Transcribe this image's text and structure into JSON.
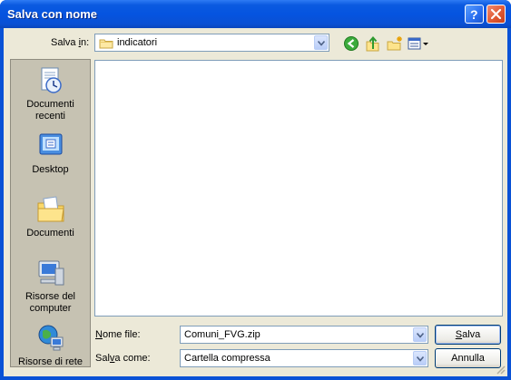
{
  "window": {
    "title": "Salva con nome"
  },
  "toolbar": {
    "look_in_label_pre": "Salva ",
    "look_in_label_key": "i",
    "look_in_label_post": "n:",
    "current_folder": "indicatori",
    "icons": [
      "back-icon",
      "up-folder-icon",
      "new-folder-icon",
      "view-menu-icon"
    ]
  },
  "places": [
    {
      "name": "place-recent",
      "label_line1": "Documenti",
      "label_line2": "recenti",
      "icon": "recent-documents-icon"
    },
    {
      "name": "place-desktop",
      "label_line1": "Desktop",
      "label_line2": "",
      "icon": "desktop-icon"
    },
    {
      "name": "place-documents",
      "label_line1": "Documenti",
      "label_line2": "",
      "icon": "my-documents-icon"
    },
    {
      "name": "place-computer",
      "label_line1": "Risorse del",
      "label_line2": "computer",
      "icon": "my-computer-icon"
    },
    {
      "name": "place-network",
      "label_line1": "Risorse di rete",
      "label_line2": "",
      "icon": "network-icon"
    }
  ],
  "form": {
    "filename_label_key": "N",
    "filename_label_rest": "ome file:",
    "filename_value": "Comuni_FVG.zip",
    "type_label_pre": "Sal",
    "type_label_key": "v",
    "type_label_post": "a come:",
    "type_value": "Cartella compressa"
  },
  "buttons": {
    "save_key": "S",
    "save_rest": "alva",
    "cancel": "Annulla"
  },
  "colors": {
    "title_bar": "#0554e0",
    "dialog_bg": "#ece9d8",
    "field_border": "#7f9db9"
  }
}
